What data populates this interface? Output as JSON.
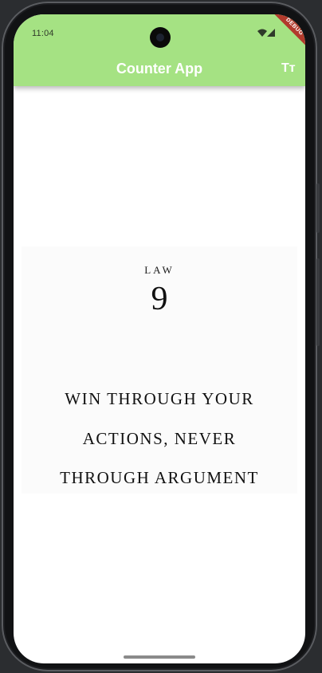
{
  "status_bar": {
    "time": "11:04",
    "icons": [
      "wifi-icon",
      "signal-icon"
    ]
  },
  "app_bar": {
    "title": "Counter App",
    "action_icon": "text-size-icon",
    "action_label": "Tт",
    "color": "#a5e283"
  },
  "debug_banner": "DEBUG",
  "content": {
    "law_label": "LAW",
    "law_number": "9",
    "law_lines": [
      "WIN THROUGH YOUR",
      "ACTIONS, NEVER",
      "THROUGH ARGUMENT"
    ]
  }
}
